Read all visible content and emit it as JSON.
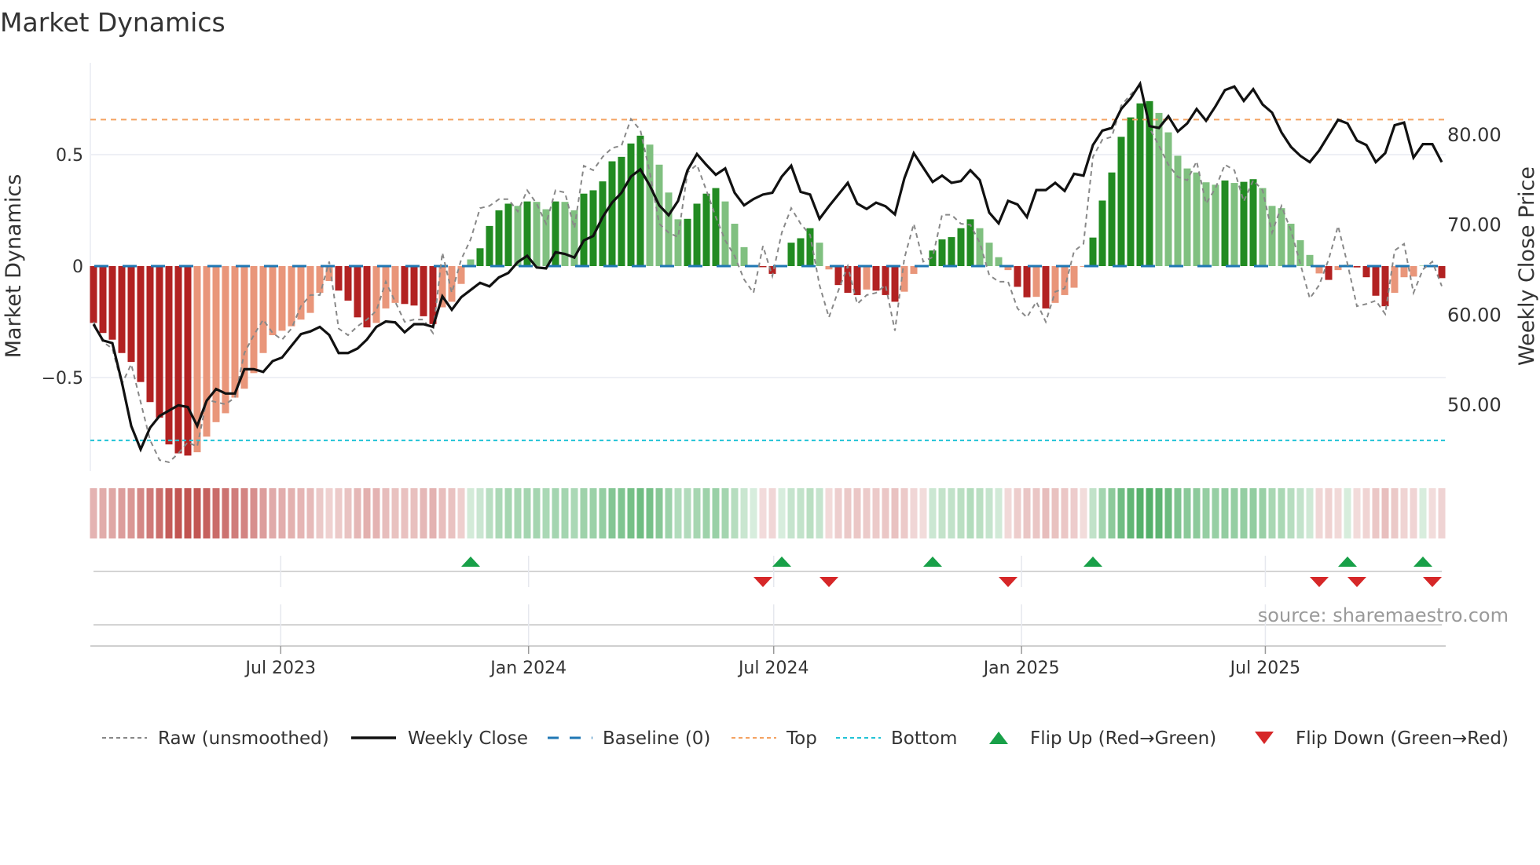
{
  "title": "Market Dynamics",
  "source": "source: sharemaestro.com",
  "colors": {
    "pos_strong": "#228b22",
    "pos_weak": "#80c080",
    "neg_strong": "#b22222",
    "neg_weak": "#e9967a",
    "close": "#111111",
    "raw": "#888888",
    "baseline": "#1f77b4",
    "top": "#f4a261",
    "bottom": "#22c3d6",
    "flip_up": "#18a048",
    "flip_down": "#d62728"
  },
  "legend": [
    {
      "key": "raw",
      "label": "Raw (unsmoothed)"
    },
    {
      "key": "close",
      "label": "Weekly Close"
    },
    {
      "key": "baseline",
      "label": "Baseline (0)"
    },
    {
      "key": "top",
      "label": "Top"
    },
    {
      "key": "bottom",
      "label": "Bottom"
    },
    {
      "key": "flip_up",
      "label": "Flip Up (Red→Green)"
    },
    {
      "key": "flip_down",
      "label": "Flip Down (Green→Red)"
    }
  ],
  "chart_data": {
    "type": "bar",
    "title": "Market Dynamics",
    "ylabel": "Market Dynamics",
    "y2label": "Weekly Close Price",
    "x_start": "2023-02-12",
    "x_freq": "weekly",
    "ylim": [
      -0.88,
      0.9
    ],
    "y2lim": [
      44,
      91
    ],
    "yticks": [
      {
        "v": 0.5,
        "label": "0.5"
      },
      {
        "v": 0,
        "label": "0"
      },
      {
        "v": -0.5,
        "label": "−0.5"
      }
    ],
    "y2ticks": [
      {
        "v": 80,
        "label": "80.00"
      },
      {
        "v": 70,
        "label": "70.00"
      },
      {
        "v": 60,
        "label": "60.00"
      },
      {
        "v": 50,
        "label": "50.00"
      }
    ],
    "xticks": [
      {
        "date": "2023-07-01",
        "label": "Jul 2023"
      },
      {
        "date": "2024-01-01",
        "label": "Jan 2024"
      },
      {
        "date": "2024-07-01",
        "label": "Jul 2024"
      },
      {
        "date": "2025-01-01",
        "label": "Jan 2025"
      },
      {
        "date": "2025-07-01",
        "label": "Jul 2025"
      }
    ],
    "top_level": 0.657,
    "bottom_level": -0.782,
    "baseline": 0,
    "grid": true,
    "legend_position": "bottom",
    "dynamics": [
      -0.255,
      -0.3,
      -0.33,
      -0.39,
      -0.43,
      -0.52,
      -0.61,
      -0.68,
      -0.8,
      -0.84,
      -0.85,
      -0.835,
      -0.765,
      -0.7,
      -0.66,
      -0.59,
      -0.55,
      -0.48,
      -0.39,
      -0.31,
      -0.29,
      -0.27,
      -0.24,
      -0.21,
      -0.12,
      -0.067,
      -0.11,
      -0.155,
      -0.23,
      -0.275,
      -0.255,
      -0.19,
      -0.165,
      -0.17,
      -0.177,
      -0.225,
      -0.26,
      -0.185,
      -0.16,
      -0.08,
      0.03,
      0.08,
      0.18,
      0.25,
      0.28,
      0.27,
      0.29,
      0.288,
      0.255,
      0.29,
      0.288,
      0.25,
      0.325,
      0.34,
      0.38,
      0.47,
      0.49,
      0.55,
      0.585,
      0.545,
      0.455,
      0.33,
      0.21,
      0.212,
      0.28,
      0.325,
      0.35,
      0.29,
      0.19,
      0.085,
      0.003,
      -0.005,
      -0.035,
      0.003,
      0.105,
      0.125,
      0.17,
      0.105,
      -0.015,
      -0.085,
      -0.12,
      -0.13,
      -0.105,
      -0.11,
      -0.13,
      -0.16,
      -0.115,
      -0.035,
      -0.003,
      0.07,
      0.12,
      0.13,
      0.17,
      0.21,
      0.17,
      0.105,
      0.04,
      -0.018,
      -0.093,
      -0.14,
      -0.138,
      -0.19,
      -0.165,
      -0.13,
      -0.097,
      -0.003,
      0.128,
      0.294,
      0.42,
      0.58,
      0.667,
      0.73,
      0.74,
      0.687,
      0.6,
      0.495,
      0.438,
      0.42,
      0.376,
      0.365,
      0.384,
      0.373,
      0.378,
      0.39,
      0.35,
      0.27,
      0.26,
      0.19,
      0.116,
      0.05,
      -0.033,
      -0.062,
      -0.018,
      0.006,
      -0.006,
      -0.05,
      -0.133,
      -0.18,
      -0.12,
      -0.05,
      -0.047,
      0.002,
      -0.003,
      -0.054
    ],
    "raw": [
      -0.25,
      -0.34,
      -0.37,
      -0.53,
      -0.44,
      -0.61,
      -0.78,
      -0.87,
      -0.88,
      -0.84,
      -0.79,
      -0.81,
      -0.6,
      -0.61,
      -0.62,
      -0.59,
      -0.39,
      -0.31,
      -0.24,
      -0.3,
      -0.33,
      -0.28,
      -0.18,
      -0.13,
      -0.13,
      0.02,
      -0.28,
      -0.31,
      -0.27,
      -0.24,
      -0.2,
      -0.07,
      -0.16,
      -0.25,
      -0.24,
      -0.24,
      -0.3,
      0.06,
      -0.12,
      0.03,
      0.12,
      0.26,
      0.27,
      0.3,
      0.3,
      0.245,
      0.34,
      0.28,
      0.19,
      0.34,
      0.33,
      0.17,
      0.45,
      0.43,
      0.49,
      0.53,
      0.54,
      0.66,
      0.61,
      0.42,
      0.19,
      0.15,
      0.13,
      0.42,
      0.455,
      0.34,
      0.22,
      0.115,
      0.045,
      -0.06,
      -0.12,
      0.09,
      -0.045,
      0.15,
      0.26,
      0.19,
      0.14,
      -0.085,
      -0.23,
      -0.11,
      0.0,
      -0.17,
      -0.13,
      -0.12,
      -0.085,
      -0.29,
      0.035,
      0.19,
      0.02,
      0.04,
      0.23,
      0.23,
      0.19,
      0.185,
      0.105,
      -0.04,
      -0.07,
      -0.07,
      -0.19,
      -0.23,
      -0.16,
      -0.25,
      -0.115,
      -0.1,
      0.067,
      0.1,
      0.49,
      0.567,
      0.58,
      0.72,
      0.77,
      0.81,
      0.62,
      0.54,
      0.455,
      0.4,
      0.385,
      0.47,
      0.28,
      0.35,
      0.455,
      0.43,
      0.29,
      0.385,
      0.34,
      0.15,
      0.27,
      0.16,
      0.01,
      -0.145,
      -0.085,
      0.03,
      0.18,
      0.01,
      -0.18,
      -0.17,
      -0.155,
      -0.215,
      0.07,
      0.1,
      -0.12,
      -0.015,
      0.02,
      -0.09
    ],
    "close": [
      58.9,
      57.1,
      56.8,
      52.5,
      47.6,
      45.0,
      47.4,
      48.7,
      49.3,
      49.9,
      49.7,
      47.6,
      50.4,
      51.7,
      51.2,
      51.2,
      53.9,
      53.9,
      53.6,
      54.8,
      55.2,
      56.5,
      57.8,
      58.1,
      58.6,
      57.7,
      55.7,
      55.7,
      56.2,
      57.2,
      58.6,
      59.2,
      59.1,
      58.0,
      58.9,
      58.9,
      58.6,
      62.0,
      60.5,
      61.9,
      62.7,
      63.5,
      63.1,
      64.1,
      64.6,
      65.8,
      66.5,
      65.2,
      65.1,
      66.9,
      66.7,
      66.3,
      68.2,
      68.7,
      70.8,
      72.4,
      73.5,
      75.3,
      76.1,
      74.3,
      72.1,
      71.0,
      72.6,
      76.0,
      77.8,
      76.6,
      75.5,
      76.2,
      73.5,
      72.1,
      72.8,
      73.3,
      73.5,
      75.3,
      76.5,
      73.6,
      73.3,
      70.6,
      72.0,
      73.3,
      74.6,
      72.3,
      71.7,
      72.4,
      72.0,
      71.1,
      75.1,
      77.9,
      76.3,
      74.7,
      75.4,
      74.6,
      74.8,
      76.0,
      74.9,
      71.3,
      70.1,
      72.6,
      72.2,
      70.8,
      73.8,
      73.8,
      74.6,
      73.7,
      75.6,
      75.4,
      78.8,
      80.4,
      80.7,
      82.8,
      84.0,
      85.6,
      80.9,
      80.7,
      82.0,
      80.3,
      81.2,
      82.8,
      81.5,
      83.1,
      84.9,
      85.3,
      83.7,
      85.0,
      83.3,
      82.4,
      80.2,
      78.6,
      77.6,
      76.9,
      78.2,
      79.9,
      81.6,
      81.2,
      79.3,
      78.8,
      76.9,
      77.9,
      81.0,
      81.3,
      77.4,
      78.9,
      78.9,
      76.9
    ]
  }
}
